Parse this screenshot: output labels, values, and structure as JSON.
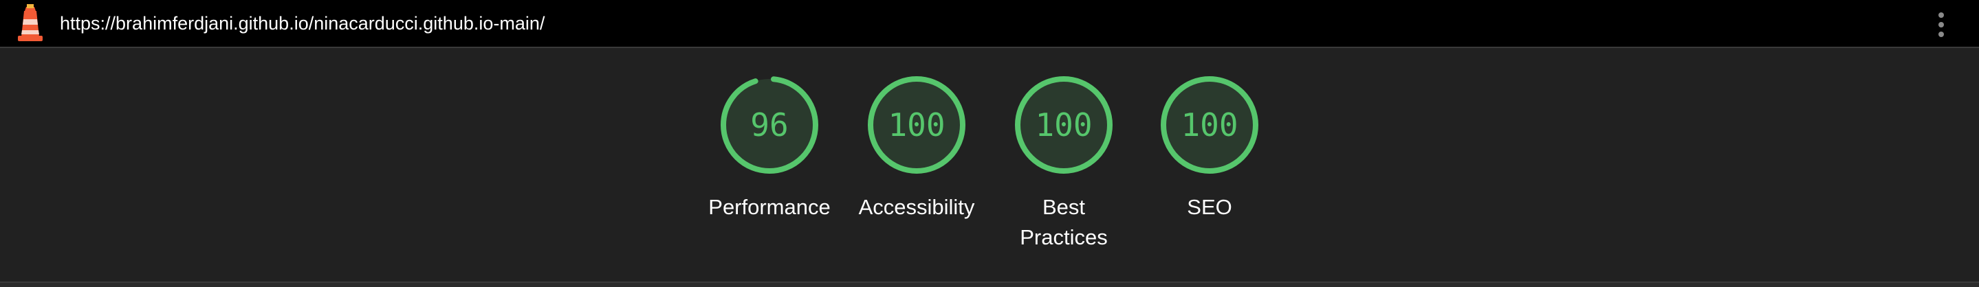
{
  "header": {
    "url": "https://brahimferdjani.github.io/ninacarducci.github.io-main/",
    "logo_icon": "lighthouse-icon",
    "menu_icon": "more-vertical-icon"
  },
  "colors": {
    "pass": "#56c66c",
    "gauge_fill": "#2a3a2d",
    "background": "#212121",
    "topbar": "#000000"
  },
  "gauges": [
    {
      "score": "96",
      "value": 96,
      "label": "Performance"
    },
    {
      "score": "100",
      "value": 100,
      "label": "Accessibility"
    },
    {
      "score": "100",
      "value": 100,
      "label": "Best Practices"
    },
    {
      "score": "100",
      "value": 100,
      "label": "SEO"
    }
  ]
}
